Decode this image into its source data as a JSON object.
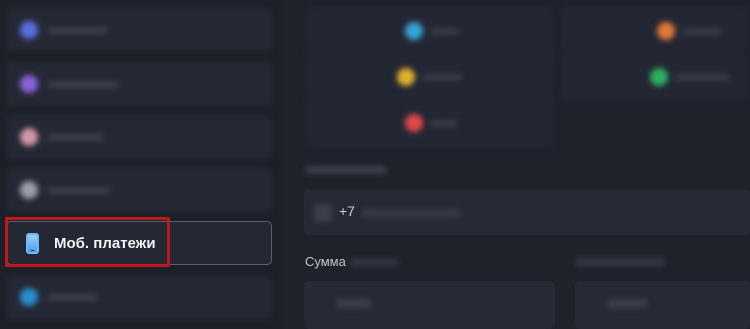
{
  "sidebar": {
    "active_item": {
      "label": "Моб. платежи",
      "icon": "mobile-phone-icon"
    },
    "blurred_item_colors": [
      "#5a6fe0",
      "#8a60d8",
      "#d19aa5",
      "#9aa0a8",
      "#2a8fd0"
    ]
  },
  "main": {
    "phone_field": {
      "prefix": "+7"
    },
    "amount_section": {
      "label": "Сумма"
    }
  },
  "highlight": {
    "color": "#c0171a"
  },
  "colors": {
    "background": "#1e222b",
    "card": "#242833",
    "accent_phone": "#6fb7ff"
  },
  "operator_dot_colors": [
    "#39a4d8",
    "#e07a3a",
    "#e2b030",
    "#2fb060",
    "#e04848"
  ]
}
